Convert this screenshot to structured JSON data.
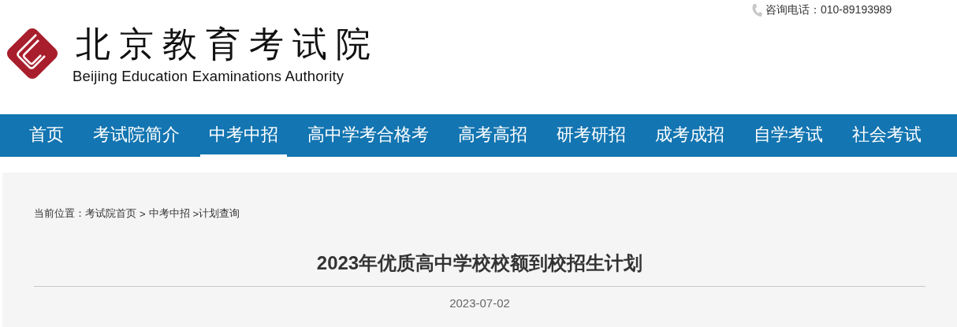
{
  "header": {
    "logo_cn": "北京教育考试院",
    "logo_en": "Beijing Education Examinations Authority",
    "hotline": "咨询电话：010-89193989"
  },
  "nav": [
    {
      "label": "首页",
      "selected": false
    },
    {
      "label": "考试院简介",
      "selected": false
    },
    {
      "label": "中考中招",
      "selected": true
    },
    {
      "label": "高中学考合格考",
      "selected": false
    },
    {
      "label": "高考高招",
      "selected": false
    },
    {
      "label": "研考研招",
      "selected": false
    },
    {
      "label": "成考成招",
      "selected": false
    },
    {
      "label": "自学考试",
      "selected": false
    },
    {
      "label": "社会考试",
      "selected": false
    }
  ],
  "breadcrumb": [
    {
      "kind": "label",
      "text": "当前位置："
    },
    {
      "kind": "link",
      "text": "考试院首页"
    },
    {
      "kind": "sep",
      "text": ">"
    },
    {
      "kind": "link",
      "text": "中考中招"
    },
    {
      "kind": "sep",
      "text": ">"
    },
    {
      "kind": "current",
      "text": "计划查询"
    }
  ],
  "article": {
    "title": "2023年优质高中学校校额到校招生计划",
    "date": "2023-07-02"
  }
}
